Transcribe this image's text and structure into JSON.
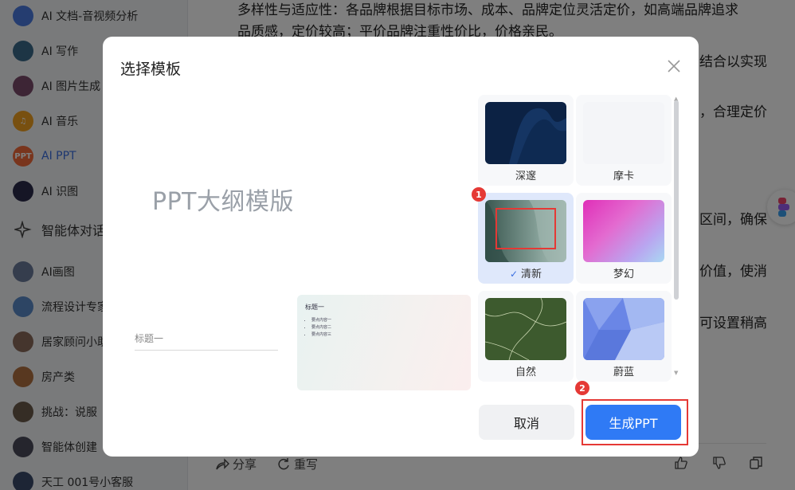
{
  "sidebar": {
    "items": [
      {
        "label": "AI 文档-音视频分析",
        "icon": "doc-audio-icon",
        "color": "#4a7be0"
      },
      {
        "label": "AI 写作",
        "icon": "writing-icon",
        "color": "#3a6a8a"
      },
      {
        "label": "AI 图片生成",
        "icon": "image-gen-icon",
        "color": "#7a4a6a"
      },
      {
        "label": "AI 音乐",
        "icon": "music-icon",
        "color": "#f0a020"
      },
      {
        "label": "AI PPT",
        "icon": "ppt-icon",
        "color": "#f26b3a",
        "badge": "PPT"
      },
      {
        "label": "AI 识图",
        "icon": "image-recognition-icon",
        "color": "#2a2a4a"
      },
      {
        "label": "智能体对话",
        "icon": "sparkle-icon"
      },
      {
        "label": "AI画图",
        "icon": "drawing-icon",
        "color": "#6a7a9a"
      },
      {
        "label": "流程设计专家",
        "icon": "flow-icon",
        "color": "#5a8ac8"
      },
      {
        "label": "居家顾问小助手",
        "icon": "home-advisor-icon",
        "color": "#8a6a5a"
      },
      {
        "label": "房产类",
        "icon": "realestate-icon",
        "color": "#b07040"
      },
      {
        "label": "挑战：说服",
        "icon": "challenge-icon",
        "color": "#6a5a4a"
      },
      {
        "label": "智能体创建",
        "icon": "agent-create-icon",
        "color": "#4a4a5a"
      },
      {
        "label": "天工 001号小客服",
        "icon": "robot-icon",
        "color": "#3a4a6a"
      }
    ]
  },
  "content": {
    "lines": [
      "多样性与适应性：各品牌根据目标市场、成本、品牌定位灵活定价，如高端品牌追求",
      "品质感，定价较高；平价品牌注重性价比，价格亲民。"
    ],
    "right_fragments": [
      "结合以实现",
      "，合理定价",
      "区间，确保",
      "价值，使消",
      "可设置稍高"
    ],
    "actions": {
      "share": "分享",
      "rewrite": "重写"
    }
  },
  "modal": {
    "title": "选择模板",
    "preview": {
      "heading": "PPT大纲模版",
      "field_label": "标题一",
      "card_title": "标题一",
      "card_items": [
        "要点内容一",
        "要点内容二",
        "要点内容三"
      ]
    },
    "templates": [
      {
        "name": "深邃",
        "selected": false
      },
      {
        "name": "摩卡",
        "selected": false
      },
      {
        "name": "清新",
        "selected": true
      },
      {
        "name": "梦幻",
        "selected": false
      },
      {
        "name": "自然",
        "selected": false
      },
      {
        "name": "蔚蓝",
        "selected": false
      }
    ],
    "selected_check": "✓",
    "cancel_label": "取消",
    "generate_label": "生成PPT",
    "markers": [
      "1",
      "2"
    ],
    "accent_color": "#2f7af5",
    "highlight_color": "#e53935"
  }
}
